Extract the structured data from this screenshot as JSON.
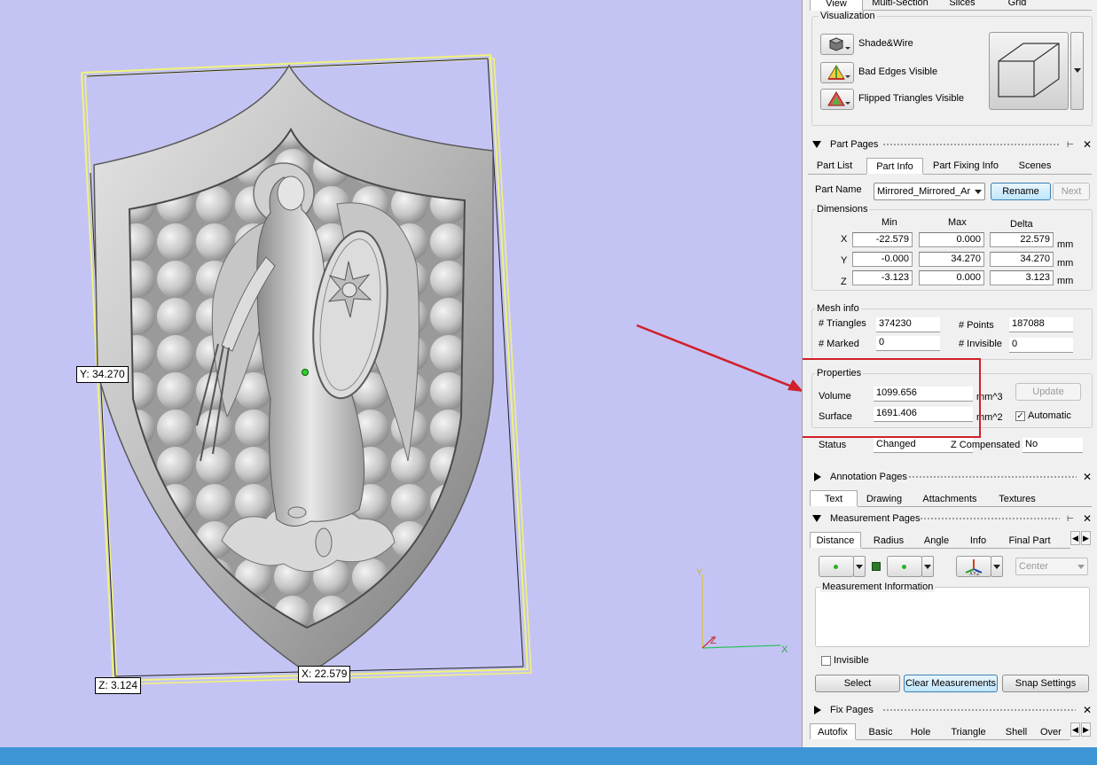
{
  "viewport": {
    "labels": {
      "y_dim": "Y: 34.270",
      "x_dim": "X: 22.579",
      "z_dim": "Z: 3.124"
    },
    "axes": {
      "y": "Y",
      "z": "Z",
      "x": "X"
    },
    "colors": {
      "background": "#c4c4f4",
      "bbox": "#f2f27a",
      "highlight": "#d0202a"
    }
  },
  "view_tabs": [
    "View",
    "Multi-Section",
    "Slices",
    "Grid"
  ],
  "visualization": {
    "title": "Visualization",
    "items": [
      {
        "label": "Shade&Wire",
        "icon": "shade-wire-icon"
      },
      {
        "label": "Bad Edges Visible",
        "icon": "bad-edges-icon"
      },
      {
        "label": "Flipped Triangles Visible",
        "icon": "flipped-triangles-icon"
      }
    ]
  },
  "part_pages": {
    "title": "Part Pages",
    "tabs": [
      "Part List",
      "Part Info",
      "Part Fixing Info",
      "Scenes"
    ],
    "part_name_label": "Part Name",
    "part_name_value": "Mirrored_Mirrored_Ar",
    "rename_label": "Rename",
    "next_label": "Next",
    "dimensions": {
      "title": "Dimensions",
      "headers": [
        "Min",
        "Max",
        "Delta"
      ],
      "rows": [
        {
          "axis": "X",
          "min": "-22.579",
          "max": "0.000",
          "delta": "22.579",
          "unit": "mm"
        },
        {
          "axis": "Y",
          "min": "-0.000",
          "max": "34.270",
          "delta": "34.270",
          "unit": "mm"
        },
        {
          "axis": "Z",
          "min": "-3.123",
          "max": "0.000",
          "delta": "3.123",
          "unit": "mm"
        }
      ]
    },
    "mesh_info": {
      "title": "Mesh info",
      "triangles_label": "# Triangles",
      "triangles": "374230",
      "points_label": "# Points",
      "points": "187088",
      "marked_label": "# Marked",
      "marked": "0",
      "invisible_label": "# Invisible",
      "invisible": "0"
    },
    "properties": {
      "title": "Properties",
      "volume_label": "Volume",
      "volume": "1099.656",
      "volume_unit": "mm^3",
      "surface_label": "Surface",
      "surface": "1691.406",
      "surface_unit": "mm^2",
      "update_label": "Update",
      "automatic_label": "Automatic",
      "automatic_checked": true
    },
    "status_label": "Status",
    "status": "Changed",
    "zcomp_label": "Z Compensated",
    "zcomp": "No"
  },
  "annotation_pages": {
    "title": "Annotation Pages",
    "tabs": [
      "Text",
      "Drawing",
      "Attachments",
      "Textures"
    ]
  },
  "measurement_pages": {
    "title": "Measurement Pages",
    "tabs": [
      "Distance",
      "Radius",
      "Angle",
      "Info",
      "Final Part"
    ],
    "center_value": "Center",
    "info_title": "Measurement Information",
    "invisible_label": "Invisible",
    "select_label": "Select",
    "clear_label": "Clear Measurements",
    "snap_label": "Snap Settings"
  },
  "fix_pages": {
    "title": "Fix Pages",
    "tabs": [
      "Autofix",
      "Basic",
      "Hole",
      "Triangle",
      "Shell",
      "Over"
    ]
  }
}
